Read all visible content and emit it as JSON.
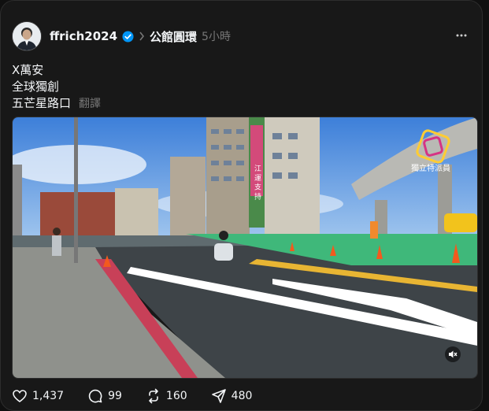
{
  "post": {
    "username": "ffrich2024",
    "topic": "公館圓環",
    "time": "5小時",
    "lines": [
      "X萬安",
      "全球獨創",
      "五芒星路口"
    ],
    "translate_label": "翻譯"
  },
  "media": {
    "watermark": "獨立特派員",
    "banner_text": "江 運 支 持"
  },
  "actions": {
    "likes": "1,437",
    "comments": "99",
    "reposts": "160",
    "shares": "480"
  },
  "icons": [
    "verified-icon",
    "more-icon",
    "mute-icon",
    "heart-icon",
    "comment-icon",
    "repost-icon",
    "share-icon"
  ],
  "colors": {
    "background": "#101010",
    "card": "#181818",
    "verified": "#0095f6",
    "muted_text": "#777777"
  }
}
